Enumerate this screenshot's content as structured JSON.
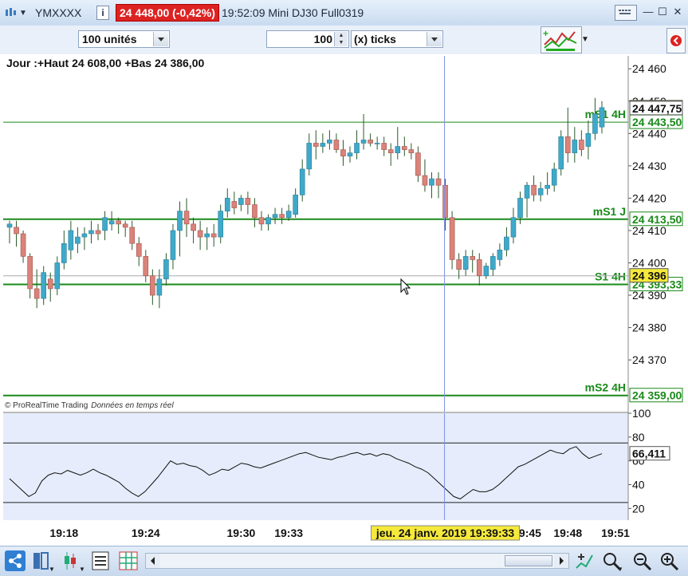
{
  "window": {
    "symbol": "YMXXXX",
    "price_badge": "24 448,00 (-0,42%)",
    "title": "19:52:09 Mini DJ30 Full0319"
  },
  "toolbar": {
    "units_value": "100 unités",
    "ticks_value": "100",
    "ticks_unit": "(x) ticks"
  },
  "chart_data": [
    {
      "type": "candlestick",
      "header": "Jour :+Haut 24 608,00 +Bas 24 386,00",
      "watermark": "© ProRealTime Trading",
      "watermark_note": "Données en temps réel",
      "ylim": [
        24354,
        24464
      ],
      "y_ticks": [
        "24 460",
        "24 450",
        "24 440",
        "24 430",
        "24 420",
        "24 410",
        "24 400",
        "24 390",
        "24 380",
        "24 370"
      ],
      "y_tick_values": [
        24460,
        24450,
        24440,
        24430,
        24420,
        24410,
        24400,
        24390,
        24380,
        24370
      ],
      "x_labels": [
        "19:18",
        "19:24",
        "19:30",
        "19:33",
        "19:45",
        "19:48",
        "19:51"
      ],
      "x_label_values": [
        8,
        20,
        34,
        41,
        76,
        82,
        89
      ],
      "crosshair_label": "jeu. 24 janv. 2019 19:39:33",
      "crosshair_index": 64,
      "levels": [
        {
          "label": "mS1 4H",
          "value_label": "24 443,50",
          "value": 24443.5,
          "color": "#1a8a1a"
        },
        {
          "label": "mS1 J",
          "value_label": "24 413,50",
          "value": 24413.5,
          "color": "#1a8a1a"
        },
        {
          "label": "S1 4H",
          "value_label": "24 393,33",
          "value": 24393.33,
          "color": "#1a8a1a"
        },
        {
          "label": "mS2 4H",
          "value_label": "24 359,00",
          "value": 24359.0,
          "color": "#1a8a1a"
        }
      ],
      "price_labels": [
        {
          "text": "24 448,00",
          "value": 24448.0
        },
        {
          "text": "24 447,75",
          "value": 24447.75
        },
        {
          "text": "24 396",
          "value": 24396.0
        }
      ],
      "candles": [
        {
          "o": 24411,
          "h": 24413,
          "l": 24406,
          "c": 24412
        },
        {
          "o": 24411,
          "h": 24413,
          "l": 24405,
          "c": 24409
        },
        {
          "o": 24409,
          "h": 24410,
          "l": 24400,
          "c": 24402
        },
        {
          "o": 24402,
          "h": 24403,
          "l": 24389,
          "c": 24392
        },
        {
          "o": 24392,
          "h": 24398,
          "l": 24386,
          "c": 24389
        },
        {
          "o": 24389,
          "h": 24399,
          "l": 24387,
          "c": 24397
        },
        {
          "o": 24395,
          "h": 24397,
          "l": 24388,
          "c": 24392
        },
        {
          "o": 24392,
          "h": 24402,
          "l": 24390,
          "c": 24400
        },
        {
          "o": 24400,
          "h": 24410,
          "l": 24398,
          "c": 24406
        },
        {
          "o": 24404,
          "h": 24413,
          "l": 24401,
          "c": 24410
        },
        {
          "o": 24406,
          "h": 24411,
          "l": 24403,
          "c": 24408
        },
        {
          "o": 24408,
          "h": 24411,
          "l": 24404,
          "c": 24409
        },
        {
          "o": 24409,
          "h": 24413,
          "l": 24406,
          "c": 24410
        },
        {
          "o": 24410,
          "h": 24412,
          "l": 24407,
          "c": 24409
        },
        {
          "o": 24410,
          "h": 24416,
          "l": 24407,
          "c": 24414
        },
        {
          "o": 24412,
          "h": 24416,
          "l": 24410,
          "c": 24413
        },
        {
          "o": 24413,
          "h": 24414,
          "l": 24409,
          "c": 24412
        },
        {
          "o": 24412,
          "h": 24413,
          "l": 24408,
          "c": 24411
        },
        {
          "o": 24411,
          "h": 24413,
          "l": 24404,
          "c": 24406
        },
        {
          "o": 24406,
          "h": 24408,
          "l": 24399,
          "c": 24402
        },
        {
          "o": 24402,
          "h": 24404,
          "l": 24394,
          "c": 24396
        },
        {
          "o": 24396,
          "h": 24398,
          "l": 24387,
          "c": 24390
        },
        {
          "o": 24390,
          "h": 24398,
          "l": 24386,
          "c": 24395
        },
        {
          "o": 24395,
          "h": 24403,
          "l": 24393,
          "c": 24401
        },
        {
          "o": 24401,
          "h": 24412,
          "l": 24398,
          "c": 24410
        },
        {
          "o": 24410,
          "h": 24419,
          "l": 24402,
          "c": 24416
        },
        {
          "o": 24416,
          "h": 24420,
          "l": 24408,
          "c": 24412
        },
        {
          "o": 24412,
          "h": 24414,
          "l": 24406,
          "c": 24410
        },
        {
          "o": 24410,
          "h": 24413,
          "l": 24404,
          "c": 24408
        },
        {
          "o": 24408,
          "h": 24411,
          "l": 24404,
          "c": 24409
        },
        {
          "o": 24409,
          "h": 24412,
          "l": 24405,
          "c": 24408
        },
        {
          "o": 24408,
          "h": 24418,
          "l": 24406,
          "c": 24416
        },
        {
          "o": 24416,
          "h": 24423,
          "l": 24414,
          "c": 24420
        },
        {
          "o": 24419,
          "h": 24422,
          "l": 24415,
          "c": 24417
        },
        {
          "o": 24418,
          "h": 24421,
          "l": 24416,
          "c": 24420
        },
        {
          "o": 24420,
          "h": 24422,
          "l": 24415,
          "c": 24418
        },
        {
          "o": 24418,
          "h": 24420,
          "l": 24411,
          "c": 24414
        },
        {
          "o": 24414,
          "h": 24416,
          "l": 24410,
          "c": 24412
        },
        {
          "o": 24412,
          "h": 24415,
          "l": 24410,
          "c": 24414
        },
        {
          "o": 24414,
          "h": 24417,
          "l": 24412,
          "c": 24415
        },
        {
          "o": 24415,
          "h": 24417,
          "l": 24412,
          "c": 24414
        },
        {
          "o": 24414,
          "h": 24418,
          "l": 24413,
          "c": 24416
        },
        {
          "o": 24415,
          "h": 24423,
          "l": 24414,
          "c": 24421
        },
        {
          "o": 24421,
          "h": 24432,
          "l": 24419,
          "c": 24429
        },
        {
          "o": 24429,
          "h": 24440,
          "l": 24427,
          "c": 24437
        },
        {
          "o": 24437,
          "h": 24441,
          "l": 24432,
          "c": 24436
        },
        {
          "o": 24436,
          "h": 24440,
          "l": 24434,
          "c": 24437
        },
        {
          "o": 24437,
          "h": 24441,
          "l": 24435,
          "c": 24438
        },
        {
          "o": 24438,
          "h": 24440,
          "l": 24434,
          "c": 24435
        },
        {
          "o": 24435,
          "h": 24438,
          "l": 24430,
          "c": 24433
        },
        {
          "o": 24433,
          "h": 24436,
          "l": 24431,
          "c": 24434
        },
        {
          "o": 24434,
          "h": 24441,
          "l": 24432,
          "c": 24437
        },
        {
          "o": 24437,
          "h": 24446,
          "l": 24435,
          "c": 24438
        },
        {
          "o": 24438,
          "h": 24440,
          "l": 24436,
          "c": 24437
        },
        {
          "o": 24437,
          "h": 24439,
          "l": 24435,
          "c": 24437
        },
        {
          "o": 24437,
          "h": 24439,
          "l": 24433,
          "c": 24435
        },
        {
          "o": 24435,
          "h": 24437,
          "l": 24430,
          "c": 24434
        },
        {
          "o": 24434,
          "h": 24442,
          "l": 24432,
          "c": 24436
        },
        {
          "o": 24436,
          "h": 24439,
          "l": 24433,
          "c": 24435
        },
        {
          "o": 24435,
          "h": 24437,
          "l": 24432,
          "c": 24434
        },
        {
          "o": 24434,
          "h": 24436,
          "l": 24425,
          "c": 24427
        },
        {
          "o": 24427,
          "h": 24432,
          "l": 24422,
          "c": 24424
        },
        {
          "o": 24424,
          "h": 24428,
          "l": 24420,
          "c": 24426
        },
        {
          "o": 24426,
          "h": 24428,
          "l": 24420,
          "c": 24424
        },
        {
          "o": 24424,
          "h": 24426,
          "l": 24410,
          "c": 24414
        },
        {
          "o": 24414,
          "h": 24416,
          "l": 24398,
          "c": 24401
        },
        {
          "o": 24401,
          "h": 24403,
          "l": 24395,
          "c": 24398
        },
        {
          "o": 24398,
          "h": 24404,
          "l": 24396,
          "c": 24402
        },
        {
          "o": 24402,
          "h": 24404,
          "l": 24397,
          "c": 24401
        },
        {
          "o": 24401,
          "h": 24403,
          "l": 24393,
          "c": 24396
        },
        {
          "o": 24396,
          "h": 24400,
          "l": 24395,
          "c": 24399
        },
        {
          "o": 24398,
          "h": 24403,
          "l": 24396,
          "c": 24402
        },
        {
          "o": 24401,
          "h": 24406,
          "l": 24399,
          "c": 24404
        },
        {
          "o": 24404,
          "h": 24411,
          "l": 24402,
          "c": 24408
        },
        {
          "o": 24408,
          "h": 24417,
          "l": 24406,
          "c": 24414
        },
        {
          "o": 24414,
          "h": 24422,
          "l": 24412,
          "c": 24420
        },
        {
          "o": 24420,
          "h": 24425,
          "l": 24414,
          "c": 24424
        },
        {
          "o": 24424,
          "h": 24427,
          "l": 24419,
          "c": 24421
        },
        {
          "o": 24421,
          "h": 24425,
          "l": 24419,
          "c": 24423
        },
        {
          "o": 24423,
          "h": 24428,
          "l": 24421,
          "c": 24424
        },
        {
          "o": 24424,
          "h": 24431,
          "l": 24422,
          "c": 24429
        },
        {
          "o": 24429,
          "h": 24441,
          "l": 24427,
          "c": 24439
        },
        {
          "o": 24439,
          "h": 24448,
          "l": 24431,
          "c": 24434
        },
        {
          "o": 24434,
          "h": 24442,
          "l": 24431,
          "c": 24438
        },
        {
          "o": 24438,
          "h": 24441,
          "l": 24433,
          "c": 24435
        },
        {
          "o": 24436,
          "h": 24444,
          "l": 24432,
          "c": 24440
        },
        {
          "o": 24440,
          "h": 24451,
          "l": 24438,
          "c": 24446
        },
        {
          "o": 24442,
          "h": 24450,
          "l": 24440,
          "c": 24448
        }
      ]
    },
    {
      "type": "line",
      "name": "oscillator",
      "ylim": [
        0,
        100
      ],
      "y_ticks": [
        "100",
        "80",
        "60",
        "40",
        "20"
      ],
      "y_tick_values": [
        100,
        80,
        60,
        40,
        20
      ],
      "h_lines": [
        75,
        25
      ],
      "last_value": "66,411",
      "values": [
        45,
        40,
        35,
        30,
        33,
        43,
        48,
        50,
        49,
        52,
        50,
        48,
        50,
        53,
        50,
        48,
        45,
        42,
        37,
        33,
        30,
        34,
        40,
        46,
        53,
        60,
        57,
        58,
        56,
        55,
        52,
        48,
        50,
        53,
        52,
        55,
        58,
        57,
        55,
        54,
        56,
        58,
        60,
        62,
        64,
        66,
        67,
        65,
        63,
        62,
        61,
        63,
        64,
        66,
        67,
        65,
        66,
        64,
        66,
        65,
        62,
        60,
        58,
        55,
        53,
        50,
        45,
        40,
        35,
        30,
        28,
        32,
        36,
        34,
        34,
        36,
        40,
        45,
        50,
        55,
        57,
        60,
        63,
        66,
        69,
        67,
        66,
        70,
        72,
        66,
        62,
        64,
        66
      ]
    }
  ]
}
